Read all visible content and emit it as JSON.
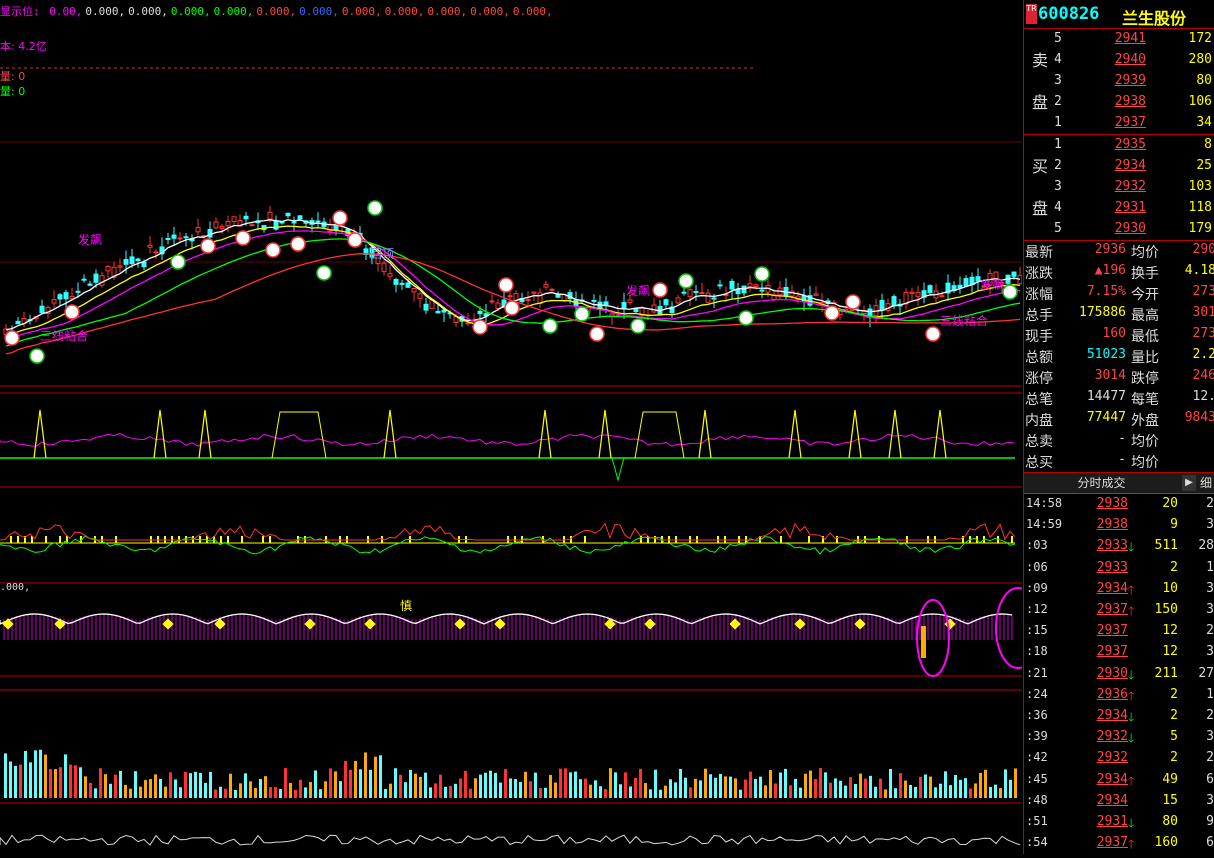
{
  "indicator_top": {
    "label": "显示位:",
    "values": [
      "0.00,",
      "0.000,",
      "0.000,",
      "0.000,",
      "0.000,",
      "0.000,",
      "0.000,",
      "0.000,",
      "0.000,",
      "0.000,",
      "0.000,",
      "0.000,"
    ],
    "colors": [
      "#f0f",
      "#ddd",
      "#ddd",
      "#0f0",
      "#0f0",
      "#f44",
      "#36f",
      "#f44",
      "#f44",
      "#f44",
      "#f44",
      "#f44"
    ]
  },
  "left_labels": {
    "cap": "本: 4.2亿",
    "vol1": "量: 0",
    "vol2": "量: 0"
  },
  "chart_annotations": {
    "fa_piao_1": "发飙",
    "fa_piao_2": "发飙",
    "fa_piao_3": "发飙",
    "san_xian": "三线粘合",
    "san_xian_2": "三线粘合",
    "guo_ding": "回顶",
    "shen_label": "慎",
    "sub3_prefix": ".000,"
  },
  "stock": {
    "badge": "TR",
    "code": "600826",
    "name": "兰生股份"
  },
  "sell_book": {
    "side_labels": [
      "卖",
      "盘"
    ],
    "rows": [
      {
        "level": "5",
        "price": "2941",
        "vol": "172"
      },
      {
        "level": "4",
        "price": "2940",
        "vol": "280"
      },
      {
        "level": "3",
        "price": "2939",
        "vol": "80"
      },
      {
        "level": "2",
        "price": "2938",
        "vol": "106"
      },
      {
        "level": "1",
        "price": "2937",
        "vol": "34"
      }
    ]
  },
  "buy_book": {
    "side_labels": [
      "买",
      "盘"
    ],
    "rows": [
      {
        "level": "1",
        "price": "2935",
        "vol": "8"
      },
      {
        "level": "2",
        "price": "2934",
        "vol": "25"
      },
      {
        "level": "3",
        "price": "2932",
        "vol": "103"
      },
      {
        "level": "4",
        "price": "2931",
        "vol": "118"
      },
      {
        "level": "5",
        "price": "2930",
        "vol": "179"
      }
    ]
  },
  "stats": [
    {
      "l1": "最新",
      "v1": "2936",
      "c1": "red",
      "l2": "均价",
      "v2": "290",
      "c2": "red"
    },
    {
      "l1": "涨跌",
      "v1": "▲196",
      "c1": "red",
      "l2": "换手",
      "v2": "4.18",
      "c2": "yel"
    },
    {
      "l1": "涨幅",
      "v1": "7.15%",
      "c1": "red",
      "l2": "今开",
      "v2": "273",
      "c2": "red"
    },
    {
      "l1": "总手",
      "v1": "175886",
      "c1": "yel",
      "l2": "最高",
      "v2": "301",
      "c2": "red"
    },
    {
      "l1": "现手",
      "v1": "160",
      "c1": "red",
      "l2": "最低",
      "v2": "273",
      "c2": "red"
    },
    {
      "l1": "总额",
      "v1": "51023",
      "c1": "cyan",
      "l2": "量比",
      "v2": "2.2",
      "c2": "yel"
    },
    {
      "l1": "涨停",
      "v1": "3014",
      "c1": "red",
      "l2": "跌停",
      "v2": "246",
      "c2": "red"
    },
    {
      "l1": "总笔",
      "v1": "14477",
      "c1": "wht",
      "l2": "每笔",
      "v2": "12.",
      "c2": "wht"
    },
    {
      "l1": "内盘",
      "v1": "77447",
      "c1": "yel",
      "l2": "外盘",
      "v2": "9843",
      "c2": "red"
    },
    {
      "l1": "总卖",
      "v1": "-",
      "c1": "wht",
      "l2": "均价",
      "v2": "",
      "c2": "wht"
    },
    {
      "l1": "总买",
      "v1": "-",
      "c1": "wht",
      "l2": "均价",
      "v2": "",
      "c2": "wht"
    }
  ],
  "ticks_header": {
    "tab": "分时成交",
    "arrow": "▶",
    "tab2": "细"
  },
  "ticks": [
    {
      "time": "14:58",
      "price": "2938",
      "dir": "",
      "vol": "20",
      "num": "2"
    },
    {
      "time": "14:59",
      "price": "2938",
      "dir": "",
      "vol": "9",
      "num": "3"
    },
    {
      "time": ":03",
      "price": "2933",
      "dir": "dn",
      "vol": "511",
      "num": "28"
    },
    {
      "time": ":06",
      "price": "2933",
      "dir": "",
      "vol": "2",
      "num": "1"
    },
    {
      "time": ":09",
      "price": "2934",
      "dir": "up",
      "vol": "10",
      "num": "3"
    },
    {
      "time": ":12",
      "price": "2937",
      "dir": "up",
      "vol": "150",
      "num": "3"
    },
    {
      "time": ":15",
      "price": "2937",
      "dir": "",
      "vol": "12",
      "num": "2"
    },
    {
      "time": ":18",
      "price": "2937",
      "dir": "",
      "vol": "12",
      "num": "3"
    },
    {
      "time": ":21",
      "price": "2930",
      "dir": "dn",
      "vol": "211",
      "num": "27"
    },
    {
      "time": ":24",
      "price": "2936",
      "dir": "up",
      "vol": "2",
      "num": "1"
    },
    {
      "time": ":36",
      "price": "2934",
      "dir": "dn",
      "vol": "2",
      "num": "2"
    },
    {
      "time": ":39",
      "price": "2932",
      "dir": "dn",
      "vol": "5",
      "num": "3"
    },
    {
      "time": ":42",
      "price": "2932",
      "dir": "",
      "vol": "2",
      "num": "2"
    },
    {
      "time": ":45",
      "price": "2934",
      "dir": "up",
      "vol": "49",
      "num": "6"
    },
    {
      "time": ":48",
      "price": "2934",
      "dir": "",
      "vol": "15",
      "num": "3"
    },
    {
      "time": ":51",
      "price": "2931",
      "dir": "dn",
      "vol": "80",
      "num": "9"
    },
    {
      "time": ":54",
      "price": "2937",
      "dir": "up",
      "vol": "160",
      "num": "6"
    }
  ],
  "colors": {
    "up": "#f33",
    "down": "#0f0",
    "accent_yellow": "#ff0",
    "divider": "#b00"
  }
}
